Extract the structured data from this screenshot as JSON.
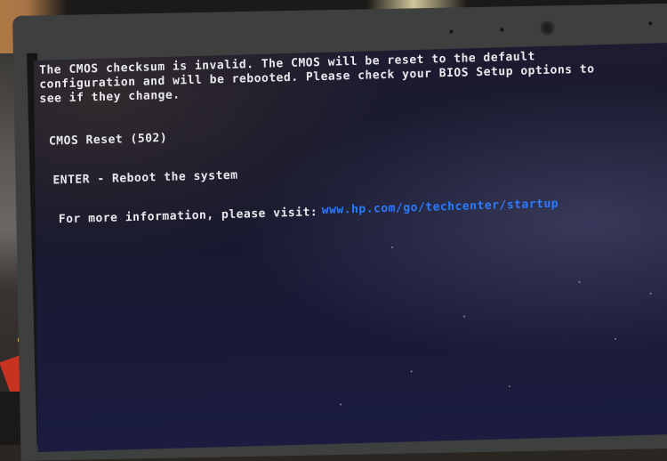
{
  "bios_screen": {
    "error_message": "The CMOS checksum is invalid. The CMOS will be reset to the default\nconfiguration and will be rebooted. Please check your BIOS Setup options to\nsee if they change.",
    "error_code_line": "CMOS Reset (502)",
    "action_line": "ENTER - Reboot the system",
    "info_prompt": "For more information, please visit:",
    "info_url": "www.hp.com/go/techcenter/startup"
  },
  "colors": {
    "screen_background": "#17182e",
    "text": "#e9e9ee",
    "link": "#2b7bff",
    "bezel": "#3e3f3f"
  }
}
